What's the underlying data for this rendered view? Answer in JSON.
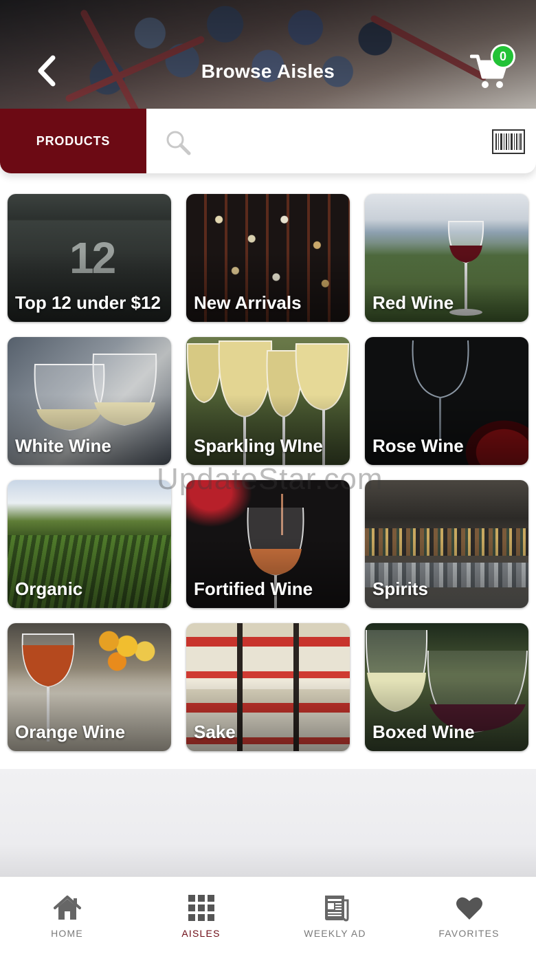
{
  "header": {
    "title": "Browse Aisles",
    "cart_count": "0",
    "back_icon": "chevron-left-icon",
    "cart_icon": "shopping-cart-icon"
  },
  "search": {
    "products_tab_label": "PRODUCTS",
    "value": "",
    "placeholder": "",
    "search_icon": "magnifier-icon",
    "barcode_icon": "barcode-icon"
  },
  "aisles": [
    {
      "label": "Top 12 under $12",
      "badge": "12"
    },
    {
      "label": "New Arrivals"
    },
    {
      "label": "Red Wine"
    },
    {
      "label": "White Wine"
    },
    {
      "label": "Sparkling WIne"
    },
    {
      "label": "Rose Wine"
    },
    {
      "label": "Organic"
    },
    {
      "label": "Fortified Wine"
    },
    {
      "label": "Spirits"
    },
    {
      "label": "Orange Wine"
    },
    {
      "label": "Sake"
    },
    {
      "label": "Boxed Wine"
    }
  ],
  "watermark": "UpdateStar.com",
  "tabs": [
    {
      "label": "HOME",
      "icon": "home-icon",
      "active": false
    },
    {
      "label": "AISLES",
      "icon": "grid-icon",
      "active": true
    },
    {
      "label": "WEEKLY AD",
      "icon": "newspaper-icon",
      "active": false
    },
    {
      "label": "FAVORITES",
      "icon": "heart-icon",
      "active": false
    }
  ],
  "colors": {
    "brand": "#6c0a14",
    "badge": "#22c236",
    "tab_inactive": "#7a7a7a"
  }
}
